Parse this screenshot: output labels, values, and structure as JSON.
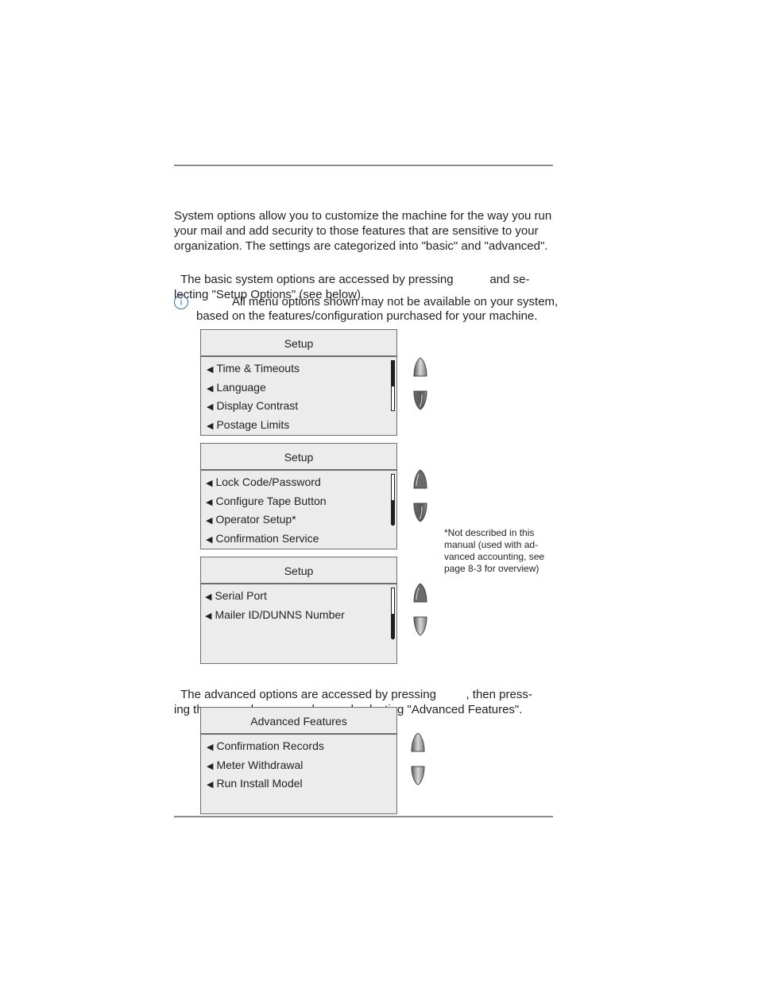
{
  "intro": {
    "paragraph1": [
      "System options allow you to customize the machine for the way you run",
      "your mail and add security to those features that are sensitive to your",
      "organization. The settings are categorized into \"basic\" and \"advanced\"."
    ],
    "paragraph2": [
      "The basic system options are accessed by pressing           and se-",
      "lecting \"Setup Options\" (see below)."
    ]
  },
  "note": {
    "icon": "info-icon",
    "icon_glyph": "i",
    "line1": "All menu options shown may not be available on your system,",
    "line2": "based on the features/configuration purchased for your machine."
  },
  "screens": [
    {
      "title": "Setup",
      "items": [
        "Time & Timeouts",
        "Language",
        "Display Contrast",
        "Postage Limits"
      ],
      "scroll_position": "top",
      "scroll_fraction_visible": 0.5
    },
    {
      "title": "Setup",
      "items": [
        "Lock Code/Password",
        "Configure Tape Button",
        "Operator Setup*",
        "Confirmation Service"
      ],
      "scroll_position": "bottom-middle",
      "scroll_fraction_visible": 0.5
    },
    {
      "title": "Setup",
      "items": [
        "Serial Port",
        "Mailer ID/DUNNS Number"
      ],
      "scroll_position": "bottom",
      "scroll_fraction_visible": 0.5
    },
    {
      "title": "Advanced Features",
      "items": [
        "Confirmation Records",
        "Meter Withdrawal",
        "Run Install Model"
      ]
    }
  ],
  "arrow_glyph": "◀",
  "keys": {
    "up": "up-arrow-key-icon",
    "down": "down-arrow-key-icon"
  },
  "footnote": [
    "*Not described in this",
    "manual (used with ad-",
    "vanced accounting, see",
    "page 8-3 for overview)"
  ],
  "advanced": {
    "paragraph": [
      "The advanced options are accessed by pressing         , then press-",
      "ing the green down arrow key and selecting \"Advanced Features\"."
    ]
  }
}
